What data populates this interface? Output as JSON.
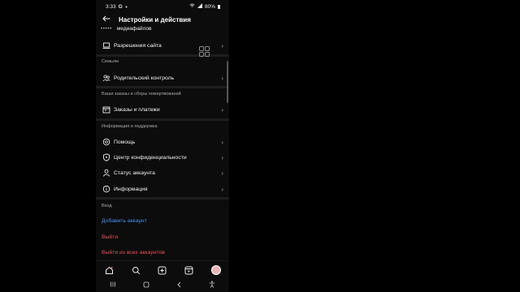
{
  "status_bar": {
    "time": "3:33",
    "g_icon": "G",
    "battery": "80%",
    "icons": [
      "wifi-icon",
      "signal-icon",
      "battery-icon"
    ]
  },
  "header": {
    "back_icon": "arrow-left-icon",
    "title": "Настройки и действия"
  },
  "content": {
    "truncated_item": "медиафайлов",
    "site_permissions": "Разрешения сайта",
    "family_section": "Семьям",
    "parental_control": "Родительский контроль",
    "orders_section": "Ваши заказы и сборы пожертвований",
    "orders_payments": "Заказы и платежи",
    "info_section": "Информация и поддержка",
    "help": "Помощь",
    "privacy_center": "Центр конфиденциальности",
    "account_status": "Статус аккаунта",
    "information": "Информация",
    "login_section": "Вход",
    "add_account": "Добавить аккаунт",
    "logout": "Выйти",
    "logout_all": "Выйти из всех аккаунтов"
  },
  "colors": {
    "background": "#0c0c0c",
    "link_blue": "#4a8ff0",
    "danger_red": "#ef4f5f",
    "section_text": "#a9a9a9"
  },
  "tab_bar": [
    "home-icon",
    "search-icon",
    "create-icon",
    "reels-icon",
    "profile-avatar"
  ],
  "nav_bar": [
    "recent-apps-icon",
    "home-button-icon",
    "back-icon",
    "accessibility-icon"
  ]
}
